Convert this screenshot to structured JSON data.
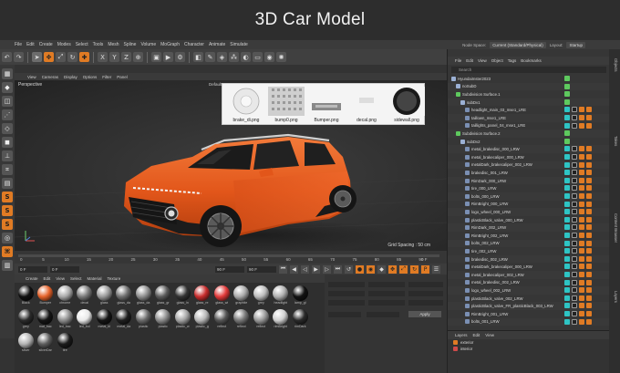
{
  "banner": {
    "title": "3D  Car Model"
  },
  "menubar": {
    "items": [
      "File",
      "Edit",
      "Create",
      "Modes",
      "Select",
      "Tools",
      "Mesh",
      "Spline",
      "Volume",
      "MoGraph",
      "Character",
      "Animate",
      "Simulate"
    ],
    "node_space_label": "Node Space:",
    "node_space_value": "Current (Standard/Physical)",
    "layout_label": "Layout:",
    "layout_value": "Startup"
  },
  "viewport": {
    "menu": [
      "View",
      "Cameras",
      "Display",
      "Options",
      "Filter",
      "Panel"
    ],
    "label": "Perspective",
    "default_camera": "Default Camera",
    "grid_spacing": "Grid Spacing : 50 cm"
  },
  "texture_popup": {
    "textures": [
      {
        "name": "brake_di.png"
      },
      {
        "name": "bump0.png"
      },
      {
        "name": "Bumper.png"
      },
      {
        "name": "decal.png"
      },
      {
        "name": "sidewall.png"
      }
    ]
  },
  "timeline": {
    "ticks": [
      "0",
      "5",
      "10",
      "15",
      "20",
      "25",
      "30",
      "35",
      "40",
      "45",
      "50",
      "55",
      "60",
      "65",
      "70",
      "75",
      "80",
      "85",
      "90"
    ],
    "end_frame": "0 F",
    "field_start": "0 F",
    "field_current": "0 F",
    "field_end_a": "90 F",
    "field_end_b": "90 F"
  },
  "materials": {
    "menu": [
      "Create",
      "Edit",
      "View",
      "Select",
      "Material",
      "Texture"
    ],
    "items": [
      {
        "label": "Black",
        "color": "#111111"
      },
      {
        "label": "Bumper",
        "color": "#e5622a"
      },
      {
        "label": "chrome",
        "color": "#a9a9a9"
      },
      {
        "label": "decal",
        "color": "#7a7a7a"
      },
      {
        "label": "glass",
        "color": "#9a9a9a"
      },
      {
        "label": "glass_da",
        "color": "#6f6f6f"
      },
      {
        "label": "glass_da",
        "color": "#8e8e8e"
      },
      {
        "label": "glass_gr",
        "color": "#5a5a5a"
      },
      {
        "label": "glass_in",
        "color": "#333333"
      },
      {
        "label": "glass_re",
        "color": "#c82d2d"
      },
      {
        "label": "glass_wi",
        "color": "#e23a3a"
      },
      {
        "label": "graphite",
        "color": "#aaaaaa"
      },
      {
        "label": "grey",
        "color": "#bcbcbc"
      },
      {
        "label": "headlight",
        "color": "#b0b0b0"
      },
      {
        "label": "lamp_gl",
        "color": "#121212"
      },
      {
        "label": "grey",
        "color": "#2b2b2b"
      },
      {
        "label": "mat_bac",
        "color": "#151515"
      },
      {
        "label": "led_bac",
        "color": "#8d8d8d"
      },
      {
        "label": "led_bul",
        "color": "#e9e9e9"
      },
      {
        "label": "metal_bl",
        "color": "#141414"
      },
      {
        "label": "metal_da",
        "color": "#1f1f1f"
      },
      {
        "label": "plastic",
        "color": "#6a6a6a"
      },
      {
        "label": "plastic",
        "color": "#8b8b8b"
      },
      {
        "label": "plastic_w",
        "color": "#a4a4a4"
      },
      {
        "label": "plastic_g",
        "color": "#b8b8b8"
      },
      {
        "label": "reflect",
        "color": "#555555"
      },
      {
        "label": "reflect",
        "color": "#777777"
      },
      {
        "label": "reflect",
        "color": "#999999"
      },
      {
        "label": "rimBright",
        "color": "#d0d0d0"
      },
      {
        "label": "rimDark",
        "color": "#2a2a2a"
      },
      {
        "label": "silver",
        "color": "#b4b4b4"
      },
      {
        "label": "silverDar",
        "color": "#5e5e5e"
      },
      {
        "label": "tire",
        "color": "#1b1b1b"
      }
    ]
  },
  "attributes": {
    "apply_label": "Apply"
  },
  "right_panel": {
    "menu": [
      "File",
      "Edit",
      "View",
      "Object",
      "Tags",
      "Bookmarks"
    ],
    "search_placeholder": "Search",
    "objects": [
      {
        "name": "HyundaiInster2023",
        "indent": 0,
        "icon": "#9bb0d4"
      },
      {
        "name": "noSubD",
        "indent": 1,
        "icon": "#9bb0d4"
      },
      {
        "name": "Subdivision Surface.1",
        "indent": 1,
        "icon": "#5ec95e"
      },
      {
        "name": "subDv1",
        "indent": 2,
        "icon": "#9bb0d4"
      },
      {
        "name": "headlight_main_03_mse1_LRE",
        "indent": 3,
        "icon": "#7a8fb3"
      },
      {
        "name": "taillown_mse1_LRE",
        "indent": 3,
        "icon": "#7a8fb3"
      },
      {
        "name": "taillights_panel_04_mse1_LRE",
        "indent": 3,
        "icon": "#7a8fb3"
      },
      {
        "name": "Subdivision Surface.2",
        "indent": 1,
        "icon": "#5ec95e"
      },
      {
        "name": "subDv2",
        "indent": 2,
        "icon": "#9bb0d4"
      },
      {
        "name": "metal_brakedisc_000_LRW",
        "indent": 3,
        "icon": "#7a8fb3"
      },
      {
        "name": "metal_brakecaliper_000_LRW",
        "indent": 3,
        "icon": "#7a8fb3"
      },
      {
        "name": "metalDark_brakecaliper_002_LRW",
        "indent": 3,
        "icon": "#7a8fb3"
      },
      {
        "name": "brakedisc_001_LRW",
        "indent": 3,
        "icon": "#7a8fb3"
      },
      {
        "name": "RimDark_000_LRW",
        "indent": 3,
        "icon": "#7a8fb3"
      },
      {
        "name": "tire_000_LRW",
        "indent": 3,
        "icon": "#7a8fb3"
      },
      {
        "name": "bolts_000_LRW",
        "indent": 3,
        "icon": "#7a8fb3"
      },
      {
        "name": "RimBright_000_LRW",
        "indent": 3,
        "icon": "#7a8fb3"
      },
      {
        "name": "logo_wheel_000_LRW",
        "indent": 3,
        "icon": "#7a8fb3"
      },
      {
        "name": "plasticBlack_valve_000_LRW",
        "indent": 3,
        "icon": "#7a8fb3"
      },
      {
        "name": "RimDark_002_LRW",
        "indent": 3,
        "icon": "#7a8fb3"
      },
      {
        "name": "RimBright_002_LRW",
        "indent": 3,
        "icon": "#7a8fb3"
      },
      {
        "name": "bolts_002_LRW",
        "indent": 3,
        "icon": "#7a8fb3"
      },
      {
        "name": "tire_002_LRW",
        "indent": 3,
        "icon": "#7a8fb3"
      },
      {
        "name": "brakedisc_002_LRW",
        "indent": 3,
        "icon": "#7a8fb3"
      },
      {
        "name": "metalDark_brakecaliper_000_LRW",
        "indent": 3,
        "icon": "#7a8fb3"
      },
      {
        "name": "metal_brakecaliper_002_LRW",
        "indent": 3,
        "icon": "#7a8fb3"
      },
      {
        "name": "metal_brakedisc_002_LRW",
        "indent": 3,
        "icon": "#7a8fb3"
      },
      {
        "name": "logo_wheel_002_LRW",
        "indent": 3,
        "icon": "#7a8fb3"
      },
      {
        "name": "plasticBlack_valve_002_LRW",
        "indent": 3,
        "icon": "#7a8fb3"
      },
      {
        "name": "plasticBlack_valve_FR_plasticBlack_003_LRW",
        "indent": 3,
        "icon": "#7a8fb3"
      },
      {
        "name": "RimBright_001_LRW",
        "indent": 3,
        "icon": "#7a8fb3"
      },
      {
        "name": "bolts_001_LRW",
        "indent": 3,
        "icon": "#7a8fb3"
      }
    ]
  },
  "layers": {
    "menu": [
      "Layers",
      "Edit",
      "View"
    ],
    "items": [
      {
        "name": "exterior",
        "color": "#e07b24"
      },
      {
        "name": "interior",
        "color": "#d04a4a"
      }
    ]
  },
  "side_tabs": [
    "Objects",
    "Takes",
    "Content Browser",
    "Layers"
  ],
  "colors": {
    "accent_orange": "#e07b24",
    "tag_teal": "#2ec4c4",
    "subdiv_green": "#5ec95e",
    "car_orange": "#e8581c"
  }
}
